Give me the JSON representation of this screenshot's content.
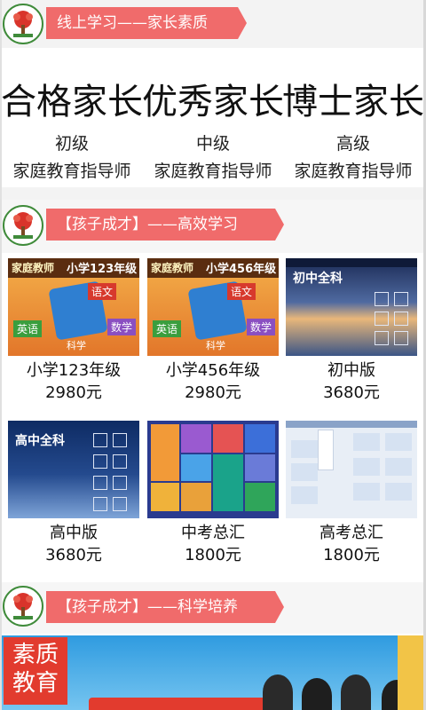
{
  "sections": [
    {
      "title": "线上学习——家长素质"
    },
    {
      "title": "【孩子成才】——高效学习"
    },
    {
      "title": "【孩子成才】——科学培养"
    }
  ],
  "levels": [
    {
      "title": "合格家长",
      "rank": "初级",
      "desc": "家庭教育指导师"
    },
    {
      "title": "优秀家长",
      "rank": "中级",
      "desc": "家庭教育指导师"
    },
    {
      "title": "博士家长",
      "rank": "高级",
      "desc": "家庭教育指导师"
    }
  ],
  "products": [
    {
      "name": "小学123年级",
      "price": "2980元"
    },
    {
      "name": "小学456年级",
      "price": "2980元"
    },
    {
      "name": "初中版",
      "price": "3680元"
    },
    {
      "name": "高中版",
      "price": "3680元"
    },
    {
      "name": "中考总汇",
      "price": "1800元"
    },
    {
      "name": "高考总汇",
      "price": "1800元"
    }
  ],
  "thumbs": {
    "p1_tag": "小学123年级",
    "p1_teacher": "家庭教师",
    "p2_tag": "小学456年级",
    "p2_teacher": "家庭教师",
    "yuwen": "语文",
    "yingyu": "英语",
    "shuxue": "数学",
    "kexue": "科学",
    "chuzhong": "初中全科",
    "gaozhong": "高中全科"
  },
  "bottom_banner": {
    "badge_line1": "素质",
    "badge_line2": "教育"
  }
}
